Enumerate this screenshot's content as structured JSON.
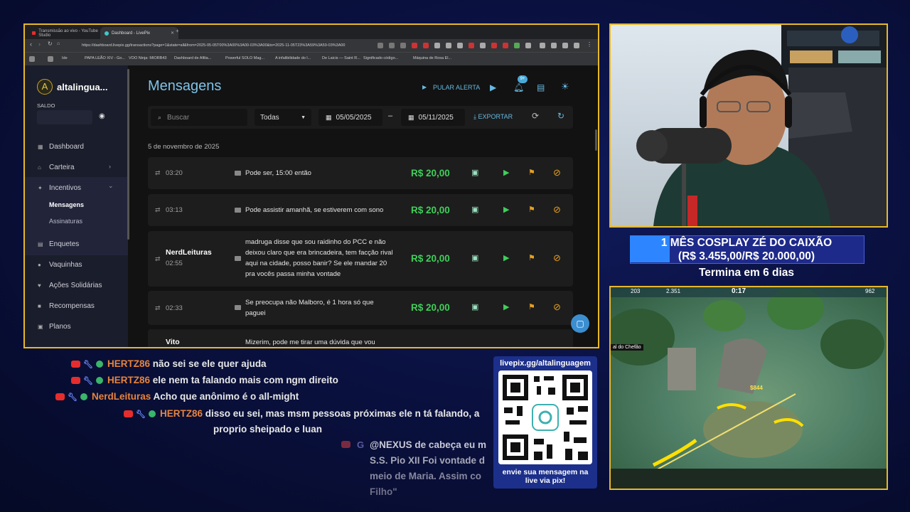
{
  "browser": {
    "tabs": [
      "Transmissão ao vivo - YouTube Studio",
      "Dashboard - LivePix"
    ],
    "url": "https://dashboard.livepix.gg/transactions?page=1&state=all&from=2025-05-05T00%3A00%3A00-03%3A00&to=2025-11-05T23%3A59%3A59-03%3A00",
    "bookmarks": [
      "Ide",
      "PAPA LEÃO XIV - Go...",
      "VOO Ninja: MIORB43",
      "Dashboard de Afilia...",
      "Powerful SOLO Mag...",
      "A infalibilidade do l...",
      "De Laicis — Saint R...",
      "Significado código...",
      "Máquina de Rosa El..."
    ]
  },
  "sidebar": {
    "brand": "altalingua...",
    "balance_label": "SALDO",
    "items": [
      {
        "label": "Dashboard",
        "icon": "grid-icon"
      },
      {
        "label": "Carteira",
        "icon": "bank-icon"
      },
      {
        "label": "Incentivos",
        "icon": "sparkle-icon"
      },
      {
        "label": "Mensagens",
        "icon": ""
      },
      {
        "label": "Assinaturas",
        "icon": ""
      },
      {
        "label": "Enquetes",
        "icon": "poll-icon"
      },
      {
        "label": "Vaquinhas",
        "icon": "piggy-icon"
      },
      {
        "label": "Ações Solidárias",
        "icon": "heart-icon"
      },
      {
        "label": "Recompensas",
        "icon": "gift-icon"
      },
      {
        "label": "Planos",
        "icon": "plan-icon"
      }
    ]
  },
  "main": {
    "title": "Mensagens",
    "skip_alert": "PULAR ALERTA",
    "notif_badge": "9+",
    "filters": {
      "search_placeholder": "Buscar",
      "status": "Todas",
      "from": "05/05/2025",
      "separator": "–",
      "to": "05/11/2025",
      "export": "EXPORTAR"
    },
    "day_label": "5 de novembro de 2025",
    "rows": [
      {
        "user": "",
        "time": "03:20",
        "message": "Pode ser, 15:00 então",
        "amount": "R$ 20,00"
      },
      {
        "user": "",
        "time": "03:13",
        "message": "Pode assistir amanhã, se estiverem com sono",
        "amount": "R$ 20,00"
      },
      {
        "user": "NerdLeituras",
        "time": "02:55",
        "message": "madruga disse que sou raidinho do PCC e não deixou claro que era brincadeira, tem facção rival aqui na cidade, posso banir? Se ele mandar 20 pra vocês passa minha vontade",
        "amount": "R$ 20,00"
      },
      {
        "user": "",
        "time": "02:33",
        "message": "Se preocupa não Malboro, é 1 hora só que paguei",
        "amount": "R$ 20,00"
      },
      {
        "user": "Vito",
        "time": "",
        "message": "Mizerim, pode me tirar uma dúvida que vou",
        "amount": ""
      }
    ]
  },
  "goal": {
    "title": "1 MÊS COSPLAY ZÉ DO CAIXÃO",
    "progress_text": "(R$ 3.455,00/R$ 20.000,00)",
    "progress_fraction": 0.17,
    "ends": "Termina em 6 dias"
  },
  "game": {
    "hud_left": "203",
    "hud_score": "2.351",
    "timer": "0:17",
    "hud_right": "962",
    "location": "al do Chefão",
    "damage": "$844"
  },
  "chat": [
    {
      "name": "HERTZ86",
      "text": "não sei se ele quer ajuda"
    },
    {
      "name": "HERTZ86",
      "text": "ele nem ta falando mais com ngm direito"
    },
    {
      "name": "NerdLeituras",
      "text": "Acho que anônimo é o all-might"
    },
    {
      "name": "HERTZ86",
      "text": "disso eu sei, mas msm pessoas próximas ele n tá falando, a",
      "cont": "proprio sheipado e luan"
    }
  ],
  "chat_faded": {
    "lines": [
      "@NEXUS de cabeça eu m",
      "S.S. Pio XII Foi vontade d",
      "meio de Maria. Assim co",
      "Filho\""
    ]
  },
  "qr": {
    "url": "livepix.gg/altalinguagem",
    "cta_line1": "envie sua mensagem na",
    "cta_line2": "live via pix!"
  },
  "colors": {
    "accent_blue": "#7ec3e8",
    "amount_green": "#3fcf5a",
    "frame_gold": "#e6b829",
    "chat_name": "#e8843a",
    "goal_fill": "#2d86ff"
  }
}
